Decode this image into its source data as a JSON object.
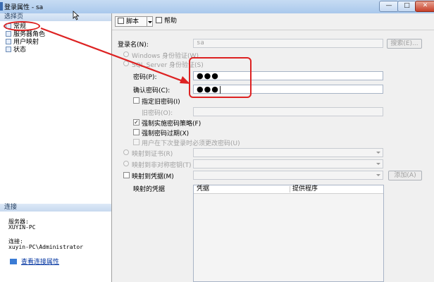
{
  "window": {
    "title": "登录属性 - sa",
    "minimize": "—",
    "maximize": "□",
    "close": "✕"
  },
  "left_pane": {
    "select_page_header": "选择页",
    "pages": [
      {
        "label": "常规",
        "icon": "page-icon"
      },
      {
        "label": "服务器角色",
        "icon": "page-icon"
      },
      {
        "label": "用户映射",
        "icon": "page-icon"
      },
      {
        "label": "状态",
        "icon": "page-icon"
      }
    ],
    "connection_header": "连接",
    "server_label": "服务器:",
    "server_value": "XUYIN-PC",
    "connection_label": "连接:",
    "connection_value": "xuyin-PC\\Administrator",
    "view_connection_link": "查看连接属性"
  },
  "toolbar": {
    "script_label": "脚本",
    "help_label": "帮助"
  },
  "form": {
    "login_name_label": "登录名(N):",
    "login_name_value": "sa",
    "search_button": "搜索(E)...",
    "windows_auth_label": "Windows 身份验证(W)",
    "sql_auth_label": "SQL Server 身份验证(S)",
    "password_label": "密码(P):",
    "password_value": "●●●",
    "confirm_password_label": "确认密码(C):",
    "confirm_password_value": "●●●|",
    "specify_old_password_label": "指定旧密码(I)",
    "old_password_label": "旧密码(O):",
    "old_password_value": "",
    "enforce_policy_label": "强制实施密码策略(F)",
    "enforce_policy_checked": true,
    "enforce_expiration_label": "强制密码过期(X)",
    "enforce_expiration_checked": false,
    "must_change_label": "用户在下次登录时必须更改密码(U)",
    "must_change_checked": false,
    "map_certificate_label": "映射到证书(R)",
    "map_asymmetric_key_label": "映射到非对称密钥(T)",
    "map_credential_label": "映射到凭据(M)",
    "add_button": "添加(A)",
    "mapped_credentials_label": "映射的凭据",
    "grid_columns": [
      "凭据",
      "提供程序"
    ]
  },
  "annotation": {
    "color": "#dd2222"
  }
}
